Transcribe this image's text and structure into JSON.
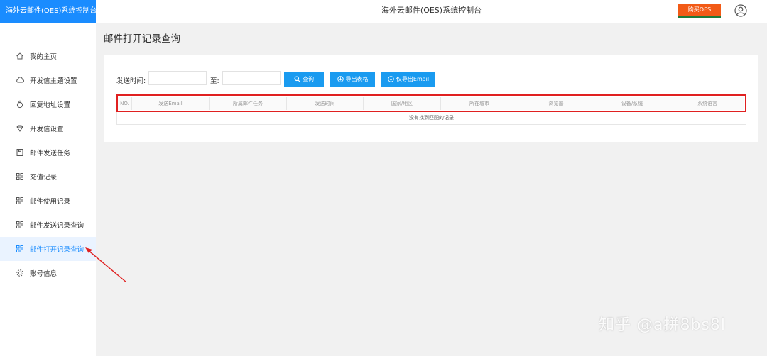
{
  "app": {
    "brand": "海外云邮件(OES)系统控制台"
  },
  "topbar": {
    "title": "海外云邮件(OES)系统控制台",
    "buy_label": "购买OES",
    "user_icon": "user-circle-icon"
  },
  "sidebar": {
    "items": [
      {
        "label": "我的主页",
        "icon": "home-icon"
      },
      {
        "label": "开发信主题设置",
        "icon": "cloud-icon"
      },
      {
        "label": "回复地址设置",
        "icon": "user-reply-icon"
      },
      {
        "label": "开发信设置",
        "icon": "diamond-icon"
      },
      {
        "label": "邮件发送任务",
        "icon": "bookmark-icon"
      },
      {
        "label": "充值记录",
        "icon": "grid-icon"
      },
      {
        "label": "邮件使用记录",
        "icon": "grid-icon"
      },
      {
        "label": "邮件发送记录查询",
        "icon": "grid-icon"
      },
      {
        "label": "邮件打开记录查询",
        "icon": "grid-icon",
        "active": true
      },
      {
        "label": "账号信息",
        "icon": "gear-icon"
      }
    ]
  },
  "page": {
    "title": "邮件打开记录查询"
  },
  "filters": {
    "send_time_label": "发送时间:",
    "to_label": "至:",
    "start_value": "",
    "end_value": "",
    "query_label": "查询",
    "export_table_label": "导出表格",
    "export_email_label": "仅导出Email"
  },
  "table": {
    "columns": [
      "NO.",
      "发送Email",
      "所属邮件任务",
      "发送时间",
      "国家/地区",
      "所在城市",
      "浏览器",
      "设备/系统",
      "系统语言"
    ],
    "empty_text": "没有找到匹配的记录"
  },
  "watermark": "知乎 @a拼8bs8l",
  "colors": {
    "accent": "#1a8cff",
    "buy": "#f25a16",
    "highlight": "#e02020"
  }
}
